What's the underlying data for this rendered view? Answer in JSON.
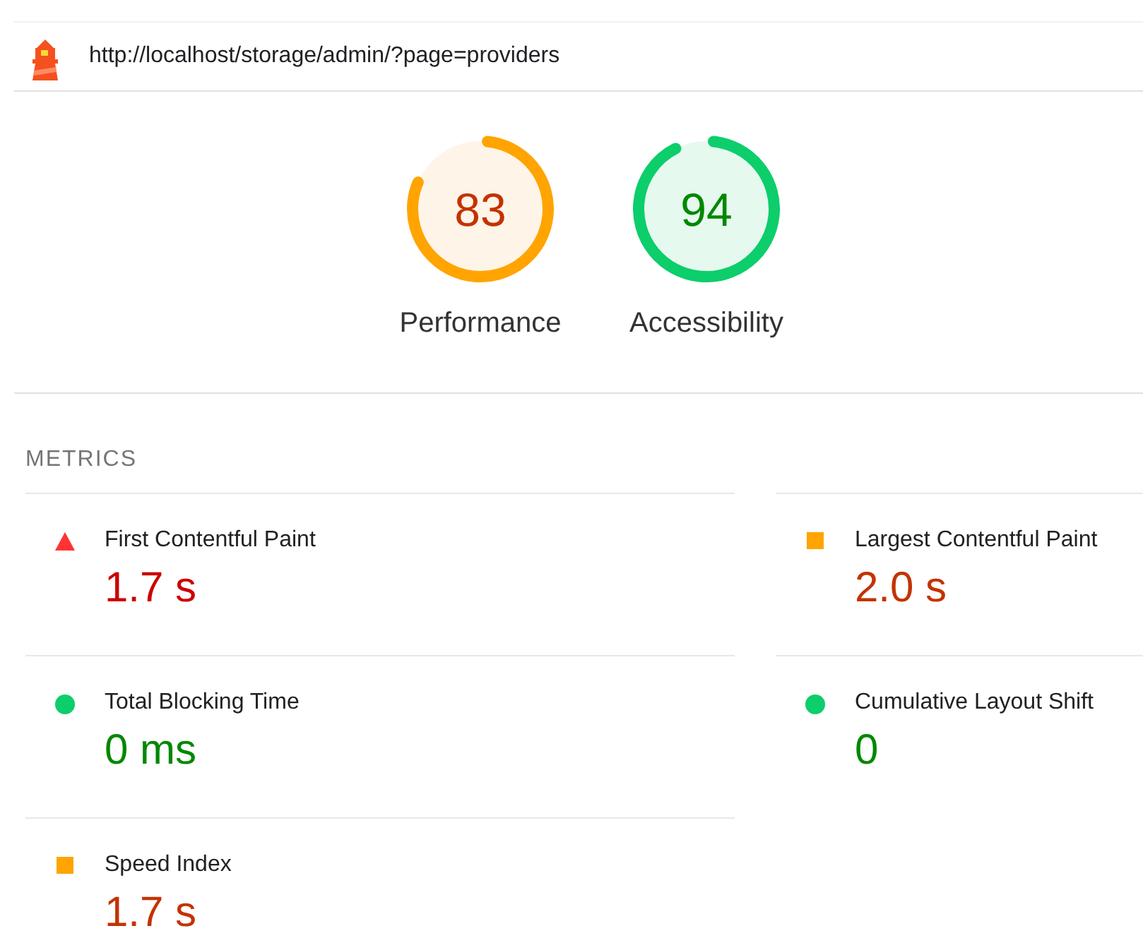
{
  "header": {
    "url": "http://localhost/storage/admin/?page=providers"
  },
  "gauges": [
    {
      "score": "83",
      "label": "Performance",
      "kind": "average"
    },
    {
      "score": "94",
      "label": "Accessibility",
      "kind": "pass"
    }
  ],
  "metrics": {
    "title": "METRICS",
    "items": [
      {
        "name": "First Contentful Paint",
        "value": "1.7 s",
        "kind": "fail"
      },
      {
        "name": "Largest Contentful Paint",
        "value": "2.0 s",
        "kind": "average"
      },
      {
        "name": "Total Blocking Time",
        "value": "0 ms",
        "kind": "pass"
      },
      {
        "name": "Cumulative Layout Shift",
        "value": "0",
        "kind": "pass"
      },
      {
        "name": "Speed Index",
        "value": "1.7 s",
        "kind": "average"
      }
    ]
  }
}
